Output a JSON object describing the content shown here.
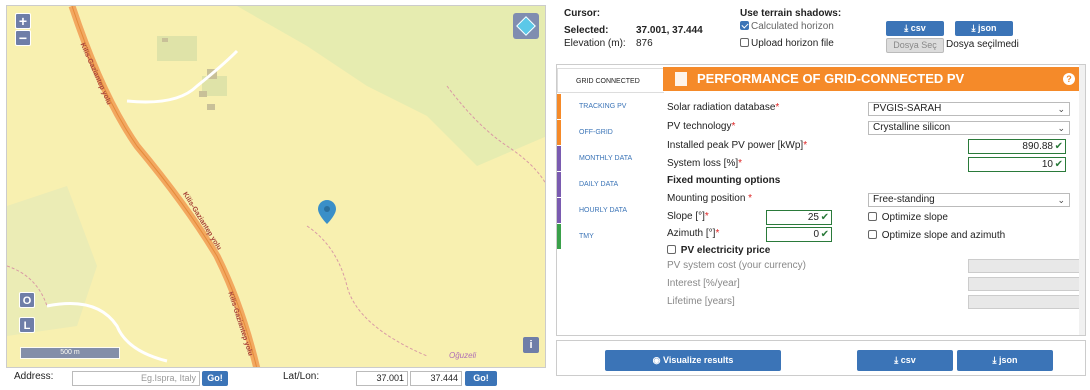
{
  "map": {
    "zoom_in": "+",
    "zoom_out": "−",
    "layer_o": "O",
    "layer_l": "L",
    "info": "i",
    "scale_label": "500 m",
    "road_labels": [
      "Kilis-Gaziantep yolu",
      "Kilis-Gaziantep yolu",
      "Kilis-Gaziantep yolu"
    ],
    "place_label": "Oğuzeli"
  },
  "address": {
    "label": "Address:",
    "placeholder": "Eg.Ispra, Italy",
    "go_label": "Go!",
    "latlon_label": "Lat/Lon:",
    "lat_value": "37.001",
    "lon_value": "37.444",
    "go2_label": "Go!"
  },
  "top": {
    "cursor_label": "Cursor:",
    "selected_label": "Selected:",
    "selected_value": "37.001, 37.444",
    "elevation_label": "Elevation (m):",
    "elevation_value": "876",
    "shadows_title": "Use terrain shadows:",
    "calc_horizon": "Calculated horizon",
    "upload_horizon": "Upload horizon file",
    "csv_label": "csv",
    "json_label": "json",
    "file_btn": "Dosya Seç",
    "file_status": "Dosya seçilmedi"
  },
  "tabs": [
    {
      "label": "GRID CONNECTED",
      "color": "#dddddd"
    },
    {
      "label": "TRACKING PV",
      "color": "#f58a29"
    },
    {
      "label": "OFF-GRID",
      "color": "#f58a29"
    },
    {
      "label": "MONTHLY DATA",
      "color": "#7a5bb0"
    },
    {
      "label": "DAILY DATA",
      "color": "#7a5bb0"
    },
    {
      "label": "HOURLY DATA",
      "color": "#7a5bb0"
    },
    {
      "label": "TMY",
      "color": "#3aa04a"
    }
  ],
  "form": {
    "title": "PERFORMANCE OF GRID-CONNECTED PV",
    "help": "?",
    "db_label": "Solar radiation database",
    "db_value": "PVGIS-SARAH",
    "tech_label": "PV technology",
    "tech_value": "Crystalline silicon",
    "power_label": "Installed peak PV power [kWp]",
    "power_value": "890.88",
    "loss_label": "System loss [%]",
    "loss_value": "10",
    "fixed_title": "Fixed mounting options",
    "mount_label": "Mounting position",
    "mount_value": "Free-standing",
    "slope_label": "Slope [°]",
    "slope_value": "25",
    "opt_slope": "Optimize slope",
    "azimuth_label": "Azimuth [°]",
    "azimuth_value": "0",
    "opt_both": "Optimize slope and azimuth",
    "price_title": "PV electricity price",
    "cost_label": "PV system cost (your currency)",
    "interest_label": "Interest [%/year]",
    "lifetime_label": "Lifetime [years]",
    "required_mark": "*"
  },
  "bottom": {
    "visualize_label": "Visualize results",
    "csv_label": "csv",
    "json_label": "json"
  }
}
